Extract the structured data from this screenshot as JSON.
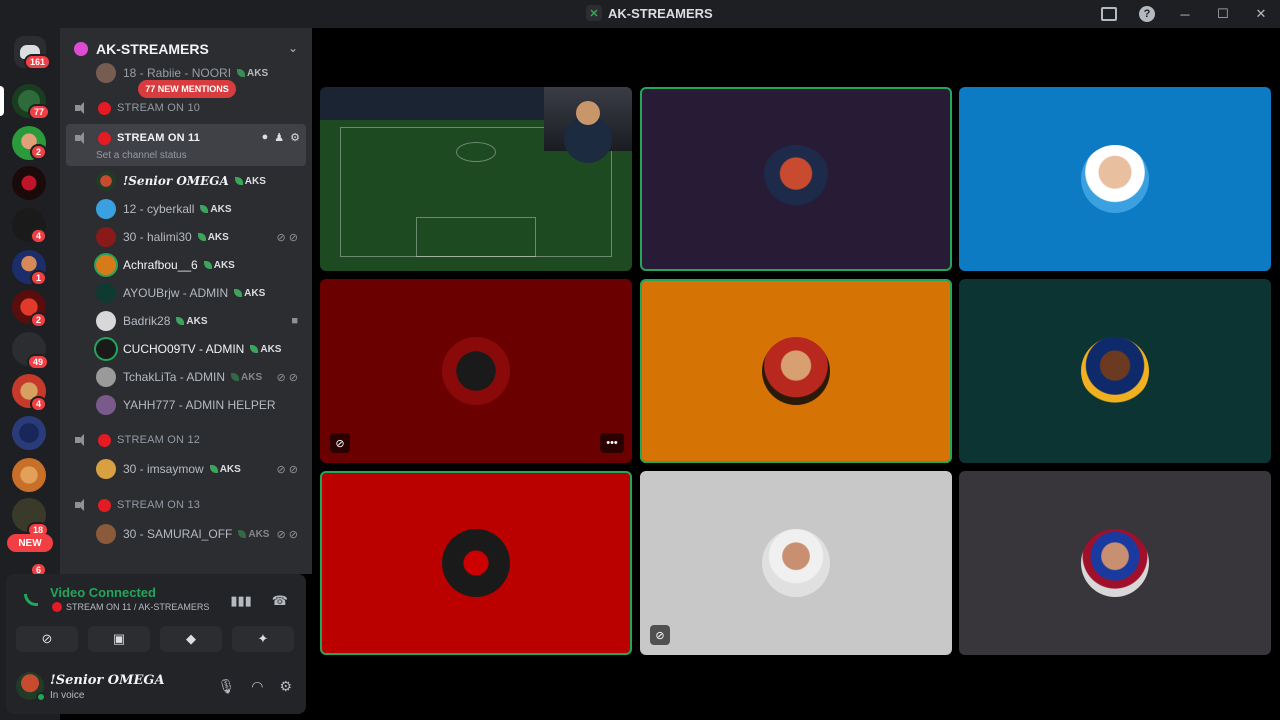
{
  "titlebar": {
    "title": "AK-STREAMERS"
  },
  "guilds": {
    "home_badge": "161",
    "badges": [
      "77",
      "2",
      "4",
      "1",
      "2",
      "49",
      "4",
      "18",
      "6"
    ],
    "new_label": "NEW"
  },
  "server": {
    "name": "AK-STREAMERS"
  },
  "channels": {
    "top_user": "18 - Rabiie - NOORI",
    "mentions": "77 NEW MENTIONS",
    "ch10": "STREAM ON 10",
    "ch11": "STREAM ON 11",
    "ch11_status": "Set a channel status",
    "ch12": "STREAM ON 12",
    "ch13": "STREAM ON 13",
    "tag": "AKS",
    "ch11_users": [
      "!Senior OMEGA",
      "12 - cyberkall",
      "30 - halimi30",
      "Achrafbou__6",
      "AYOUBrjw - ADMIN",
      "Badrik28",
      "CUCHO09TV - ADMIN",
      "TchakLiTa - ADMIN",
      "YAHH777 - ADMIN HELPER"
    ],
    "ch12_users": [
      "30 - imsaymow"
    ],
    "ch13_users": [
      "30 - SAMURAI_OFF"
    ]
  },
  "voice": {
    "title": "Video Connected",
    "subtitle": "STREAM ON 11 / AK-STREAMERS"
  },
  "user": {
    "name": "!Senior OMEGA",
    "status": "In voice"
  },
  "colors": {
    "accent_green": "#23a55a",
    "danger_red": "#f23f43",
    "stream_red": "#e41b23"
  },
  "icons": [
    "inbox-icon",
    "help-icon",
    "minimize-icon",
    "maximize-icon",
    "close-icon",
    "speaker-icon",
    "signal-icon",
    "soundboard-icon",
    "disconnect-icon",
    "camera-off-icon",
    "screen-share-icon",
    "activity-icon",
    "soundboard-effects-icon",
    "mic-icon",
    "headphones-icon",
    "gear-icon",
    "more-icon"
  ]
}
